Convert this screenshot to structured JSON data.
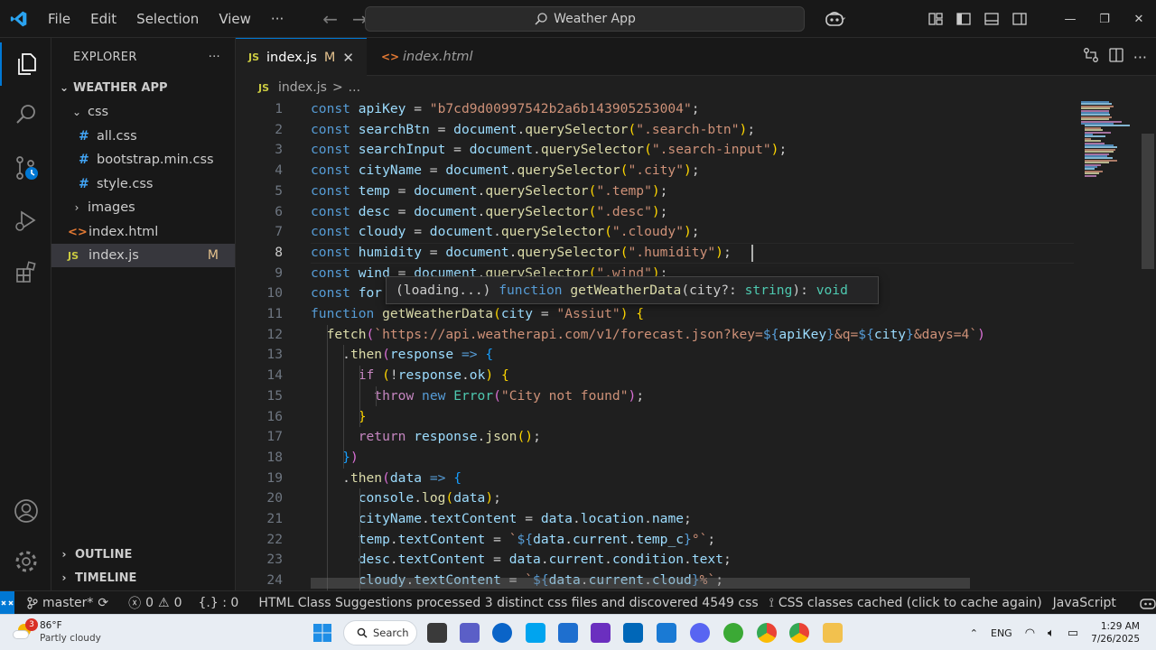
{
  "titlebar": {
    "menus": [
      "File",
      "Edit",
      "Selection",
      "View"
    ],
    "more": "···",
    "search_text": "Weather App"
  },
  "sidebar": {
    "title": "EXPLORER",
    "more": "···",
    "root": "WEATHER APP",
    "items": [
      {
        "label": "css",
        "kind": "folder-open"
      },
      {
        "label": "all.css",
        "kind": "css"
      },
      {
        "label": "bootstrap.min.css",
        "kind": "css"
      },
      {
        "label": "style.css",
        "kind": "css"
      },
      {
        "label": "images",
        "kind": "folder"
      },
      {
        "label": "index.html",
        "kind": "html"
      },
      {
        "label": "index.js",
        "kind": "js",
        "badge": "M"
      }
    ],
    "outline": "OUTLINE",
    "timeline": "TIMELINE"
  },
  "tabs": [
    {
      "icon": "JS",
      "label": "index.js",
      "modified": "M",
      "active": true
    },
    {
      "icon": "<>",
      "label": "index.html",
      "active": false
    }
  ],
  "breadcrumb": {
    "icon": "JS",
    "file": "index.js",
    "sep": ">",
    "rest": "..."
  },
  "hover": {
    "loading": "(loading...)",
    "keyword": "function",
    "signature": "getWeatherData",
    "param": "(city?: ",
    "type": "string",
    "ret": "): ",
    "void": "void"
  },
  "code": {
    "line_numbers": [
      "1",
      "2",
      "3",
      "4",
      "5",
      "6",
      "7",
      "8",
      "9",
      "10",
      "11",
      "12",
      "13",
      "14",
      "15",
      "16",
      "17",
      "18",
      "19",
      "20",
      "21",
      "22",
      "23",
      "24"
    ],
    "current_line": "8",
    "lines": [
      {
        "t": [
          [
            "k",
            "const "
          ],
          [
            "v",
            "apiKey"
          ],
          [
            "p",
            " = "
          ],
          [
            "s",
            "\"b7cd9d00997542b2a6b143905253004\""
          ],
          [
            "p",
            ";"
          ]
        ]
      },
      {
        "t": [
          [
            "k",
            "const "
          ],
          [
            "v",
            "searchBtn"
          ],
          [
            "p",
            " = "
          ],
          [
            "v",
            "document"
          ],
          [
            "p",
            "."
          ],
          [
            "f",
            "querySelector"
          ],
          [
            "b1",
            "("
          ],
          [
            "s",
            "\".search-btn\""
          ],
          [
            "b1",
            ")"
          ],
          [
            "p",
            ";"
          ]
        ]
      },
      {
        "t": [
          [
            "k",
            "const "
          ],
          [
            "v",
            "searchInput"
          ],
          [
            "p",
            " = "
          ],
          [
            "v",
            "document"
          ],
          [
            "p",
            "."
          ],
          [
            "f",
            "querySelector"
          ],
          [
            "b1",
            "("
          ],
          [
            "s",
            "\".search-input\""
          ],
          [
            "b1",
            ")"
          ],
          [
            "p",
            ";"
          ]
        ]
      },
      {
        "t": [
          [
            "k",
            "const "
          ],
          [
            "v",
            "cityName"
          ],
          [
            "p",
            " = "
          ],
          [
            "v",
            "document"
          ],
          [
            "p",
            "."
          ],
          [
            "f",
            "querySelector"
          ],
          [
            "b1",
            "("
          ],
          [
            "s",
            "\".city\""
          ],
          [
            "b1",
            ")"
          ],
          [
            "p",
            ";"
          ]
        ]
      },
      {
        "t": [
          [
            "k",
            "const "
          ],
          [
            "v",
            "temp"
          ],
          [
            "p",
            " = "
          ],
          [
            "v",
            "document"
          ],
          [
            "p",
            "."
          ],
          [
            "f",
            "querySelector"
          ],
          [
            "b1",
            "("
          ],
          [
            "s",
            "\".temp\""
          ],
          [
            "b1",
            ")"
          ],
          [
            "p",
            ";"
          ]
        ]
      },
      {
        "t": [
          [
            "k",
            "const "
          ],
          [
            "v",
            "desc"
          ],
          [
            "p",
            " = "
          ],
          [
            "v",
            "document"
          ],
          [
            "p",
            "."
          ],
          [
            "f",
            "querySelector"
          ],
          [
            "b1",
            "("
          ],
          [
            "s",
            "\".desc\""
          ],
          [
            "b1",
            ")"
          ],
          [
            "p",
            ";"
          ]
        ]
      },
      {
        "t": [
          [
            "k",
            "const "
          ],
          [
            "v",
            "cloudy"
          ],
          [
            "p",
            " = "
          ],
          [
            "v",
            "document"
          ],
          [
            "p",
            "."
          ],
          [
            "f",
            "querySelector"
          ],
          [
            "b1",
            "("
          ],
          [
            "s",
            "\".cloudy\""
          ],
          [
            "b1",
            ")"
          ],
          [
            "p",
            ";"
          ]
        ]
      },
      {
        "t": [
          [
            "k",
            "const "
          ],
          [
            "v",
            "humidity"
          ],
          [
            "p",
            " = "
          ],
          [
            "v",
            "document"
          ],
          [
            "p",
            "."
          ],
          [
            "f",
            "querySelector"
          ],
          [
            "b1",
            "("
          ],
          [
            "s",
            "\".humidity\""
          ],
          [
            "b1",
            ")"
          ],
          [
            "p",
            ";"
          ]
        ]
      },
      {
        "t": [
          [
            "k",
            "const "
          ],
          [
            "v",
            "wind"
          ],
          [
            "p",
            " = "
          ],
          [
            "v",
            "document"
          ],
          [
            "p",
            "."
          ],
          [
            "f",
            "querySelector"
          ],
          [
            "b1",
            "("
          ],
          [
            "s",
            "\".wind\""
          ],
          [
            "b1",
            ")"
          ],
          [
            "p",
            ";"
          ]
        ]
      },
      {
        "t": [
          [
            "k",
            "const "
          ],
          [
            "v",
            "for"
          ],
          [
            "p",
            "                                                   "
          ],
          [
            "s",
            "\""
          ],
          [
            "b1",
            ")"
          ],
          [
            "p",
            ";"
          ]
        ]
      },
      {
        "t": [
          [
            "k",
            "function "
          ],
          [
            "f",
            "getWeatherData"
          ],
          [
            "b1",
            "("
          ],
          [
            "v",
            "city"
          ],
          [
            "p",
            " = "
          ],
          [
            "s",
            "\"Assiut\""
          ],
          [
            "b1",
            ")"
          ],
          [
            "p",
            " "
          ],
          [
            "b1",
            "{"
          ]
        ]
      },
      {
        "t": [
          [
            "p",
            "  "
          ],
          [
            "f",
            "fetch"
          ],
          [
            "b2",
            "("
          ],
          [
            "s",
            "`https://api.weatherapi.com/v1/forecast.json?key="
          ],
          [
            "tpl",
            "${"
          ],
          [
            "v",
            "apiKey"
          ],
          [
            "tpl",
            "}"
          ],
          [
            "s",
            "&q="
          ],
          [
            "tpl",
            "${"
          ],
          [
            "v",
            "city"
          ],
          [
            "tpl",
            "}"
          ],
          [
            "s",
            "&days=4`"
          ],
          [
            "b2",
            ")"
          ]
        ]
      },
      {
        "t": [
          [
            "p",
            "    ."
          ],
          [
            "f",
            "then"
          ],
          [
            "b2",
            "("
          ],
          [
            "v",
            "response"
          ],
          [
            "p",
            " "
          ],
          [
            "k",
            "=>"
          ],
          [
            "p",
            " "
          ],
          [
            "b3",
            "{"
          ]
        ]
      },
      {
        "t": [
          [
            "p",
            "      "
          ],
          [
            "ctl",
            "if"
          ],
          [
            "p",
            " "
          ],
          [
            "b1",
            "("
          ],
          [
            "p",
            "!"
          ],
          [
            "v",
            "response"
          ],
          [
            "p",
            "."
          ],
          [
            "v",
            "ok"
          ],
          [
            "b1",
            ")"
          ],
          [
            "p",
            " "
          ],
          [
            "b1",
            "{"
          ]
        ]
      },
      {
        "t": [
          [
            "p",
            "        "
          ],
          [
            "ctl",
            "throw"
          ],
          [
            "p",
            " "
          ],
          [
            "k",
            "new"
          ],
          [
            "p",
            " "
          ],
          [
            "c",
            "Error"
          ],
          [
            "b2",
            "("
          ],
          [
            "s",
            "\"City not found\""
          ],
          [
            "b2",
            ")"
          ],
          [
            "p",
            ";"
          ]
        ]
      },
      {
        "t": [
          [
            "p",
            "      "
          ],
          [
            "b1",
            "}"
          ]
        ]
      },
      {
        "t": [
          [
            "p",
            "      "
          ],
          [
            "ctl",
            "return"
          ],
          [
            "p",
            " "
          ],
          [
            "v",
            "response"
          ],
          [
            "p",
            "."
          ],
          [
            "f",
            "json"
          ],
          [
            "b1",
            "()"
          ],
          [
            "p",
            ";"
          ]
        ]
      },
      {
        "t": [
          [
            "p",
            "    "
          ],
          [
            "b3",
            "}"
          ],
          [
            "b2",
            ")"
          ]
        ]
      },
      {
        "t": [
          [
            "p",
            "    ."
          ],
          [
            "f",
            "then"
          ],
          [
            "b2",
            "("
          ],
          [
            "v",
            "data"
          ],
          [
            "p",
            " "
          ],
          [
            "k",
            "=>"
          ],
          [
            "p",
            " "
          ],
          [
            "b3",
            "{"
          ]
        ]
      },
      {
        "t": [
          [
            "p",
            "      "
          ],
          [
            "v",
            "console"
          ],
          [
            "p",
            "."
          ],
          [
            "f",
            "log"
          ],
          [
            "b1",
            "("
          ],
          [
            "v",
            "data"
          ],
          [
            "b1",
            ")"
          ],
          [
            "p",
            ";"
          ]
        ]
      },
      {
        "t": [
          [
            "p",
            "      "
          ],
          [
            "v",
            "cityName"
          ],
          [
            "p",
            "."
          ],
          [
            "v",
            "textContent"
          ],
          [
            "p",
            " = "
          ],
          [
            "v",
            "data"
          ],
          [
            "p",
            "."
          ],
          [
            "v",
            "location"
          ],
          [
            "p",
            "."
          ],
          [
            "v",
            "name"
          ],
          [
            "p",
            ";"
          ]
        ]
      },
      {
        "t": [
          [
            "p",
            "      "
          ],
          [
            "v",
            "temp"
          ],
          [
            "p",
            "."
          ],
          [
            "v",
            "textContent"
          ],
          [
            "p",
            " = "
          ],
          [
            "s",
            "`"
          ],
          [
            "tpl",
            "${"
          ],
          [
            "v",
            "data"
          ],
          [
            "p",
            "."
          ],
          [
            "v",
            "current"
          ],
          [
            "p",
            "."
          ],
          [
            "v",
            "temp_c"
          ],
          [
            "tpl",
            "}"
          ],
          [
            "s",
            "°`"
          ],
          [
            "p",
            ";"
          ]
        ]
      },
      {
        "t": [
          [
            "p",
            "      "
          ],
          [
            "v",
            "desc"
          ],
          [
            "p",
            "."
          ],
          [
            "v",
            "textContent"
          ],
          [
            "p",
            " = "
          ],
          [
            "v",
            "data"
          ],
          [
            "p",
            "."
          ],
          [
            "v",
            "current"
          ],
          [
            "p",
            "."
          ],
          [
            "v",
            "condition"
          ],
          [
            "p",
            "."
          ],
          [
            "v",
            "text"
          ],
          [
            "p",
            ";"
          ]
        ]
      },
      {
        "t": [
          [
            "p",
            "      "
          ],
          [
            "v",
            "cloudy"
          ],
          [
            "p",
            "."
          ],
          [
            "v",
            "textContent"
          ],
          [
            "p",
            " = "
          ],
          [
            "s",
            "`"
          ],
          [
            "tpl",
            "${"
          ],
          [
            "v",
            "data"
          ],
          [
            "p",
            "."
          ],
          [
            "v",
            "current"
          ],
          [
            "p",
            "."
          ],
          [
            "v",
            "cloud"
          ],
          [
            "tpl",
            "}"
          ],
          [
            "s",
            "%`"
          ],
          [
            "p",
            ";"
          ]
        ]
      }
    ]
  },
  "statusbar": {
    "branch": "master*",
    "errors": "0",
    "warnings": "0",
    "selection": "{.} : 0",
    "message": "HTML Class Suggestions processed 3 distinct css files and discovered 4549 css",
    "cache": "CSS classes cached (click to cache again)",
    "language": "JavaScript"
  },
  "taskbar": {
    "weather_badge": "3",
    "temp": "86°F",
    "condition": "Partly cloudy",
    "search": "Search",
    "lang": "ENG",
    "time": "1:29 AM",
    "date": "7/26/2025"
  }
}
